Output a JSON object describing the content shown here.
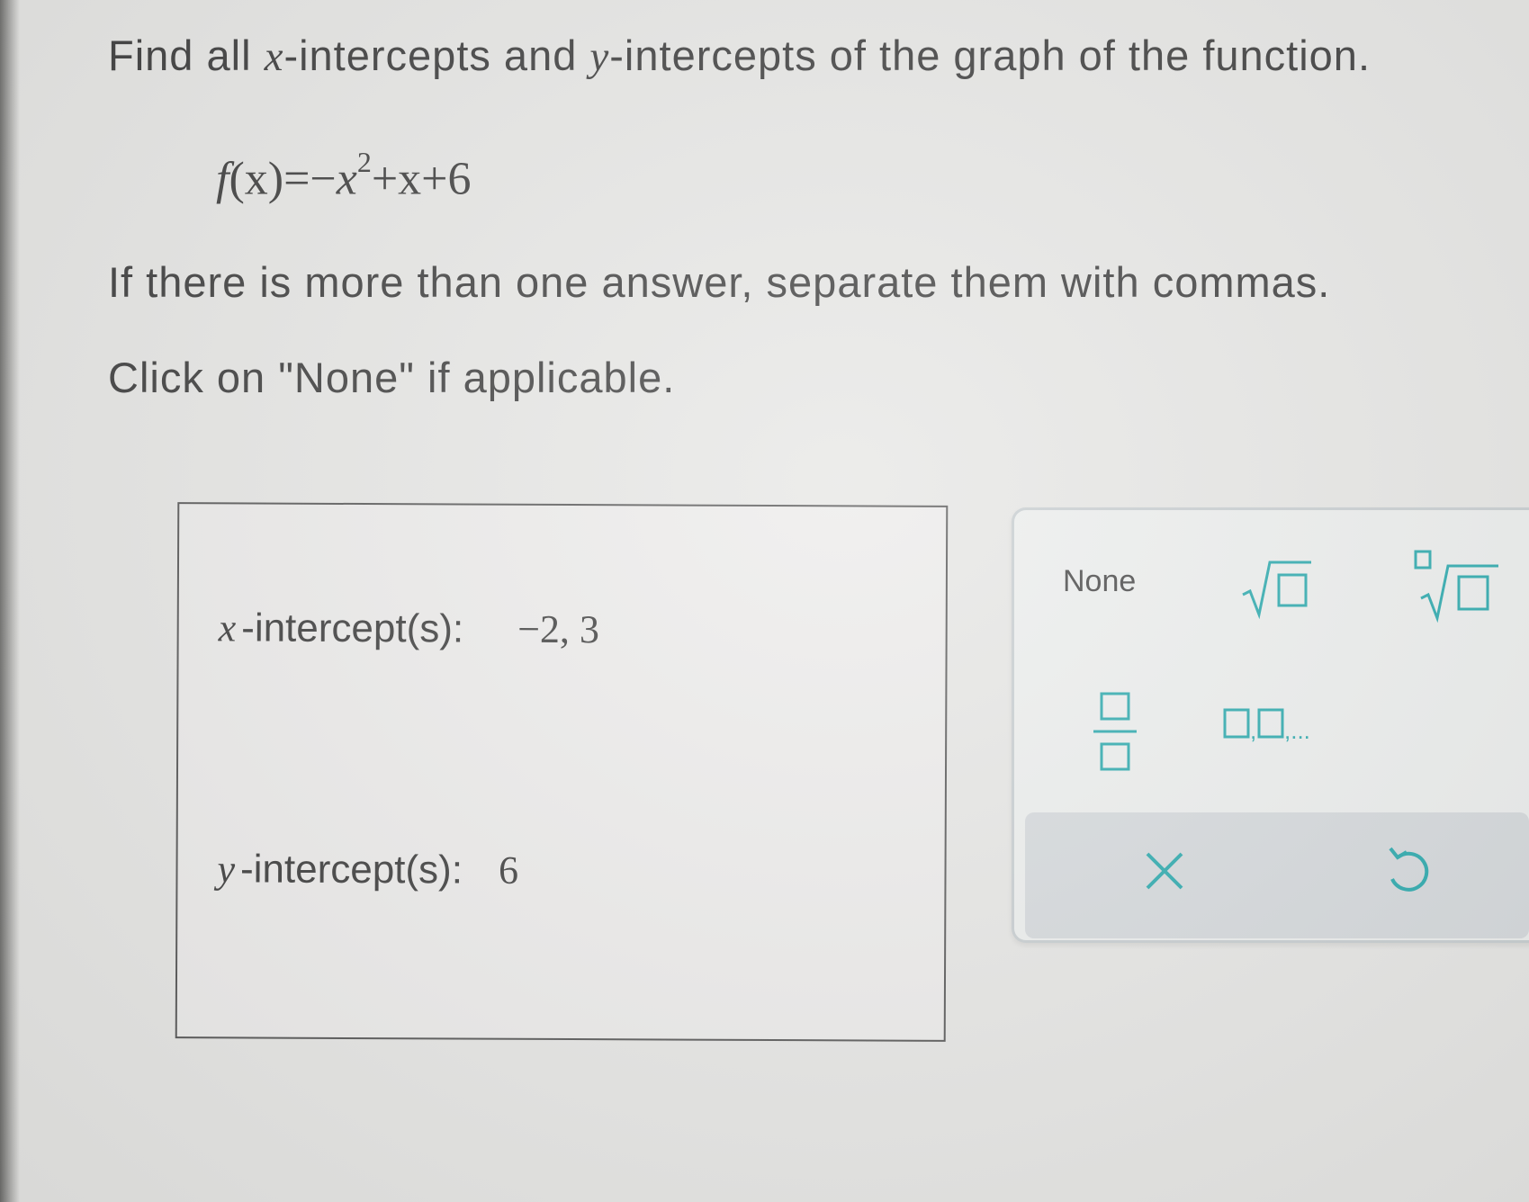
{
  "question": {
    "line1_parts": [
      "Find all ",
      "x",
      "-intercepts and ",
      "y",
      "-intercepts of the graph of the function."
    ],
    "formula": {
      "lhs_fn": "f",
      "lhs_arg": "(x)",
      "equals": "=",
      "neg": "−",
      "var": "x",
      "exponent": "2",
      "rest": "+x+6"
    },
    "line2": "If there is more than one answer, separate them with commas.",
    "line3": "Click on \"None\" if applicable."
  },
  "answers": {
    "x_label_var": "x",
    "x_label_text": "-intercept(s):",
    "x_value": "−2, 3",
    "y_label_var": "y",
    "y_label_text": "-intercept(s):",
    "y_value": "6"
  },
  "keypad": {
    "none_label": "None",
    "list_label": "□,□,...",
    "icons": [
      "sqrt-icon",
      "nth-root-icon",
      "fraction-icon",
      "list-icon",
      "clear-x-icon",
      "undo-icon"
    ],
    "accent_color": "#2aa9ad"
  }
}
